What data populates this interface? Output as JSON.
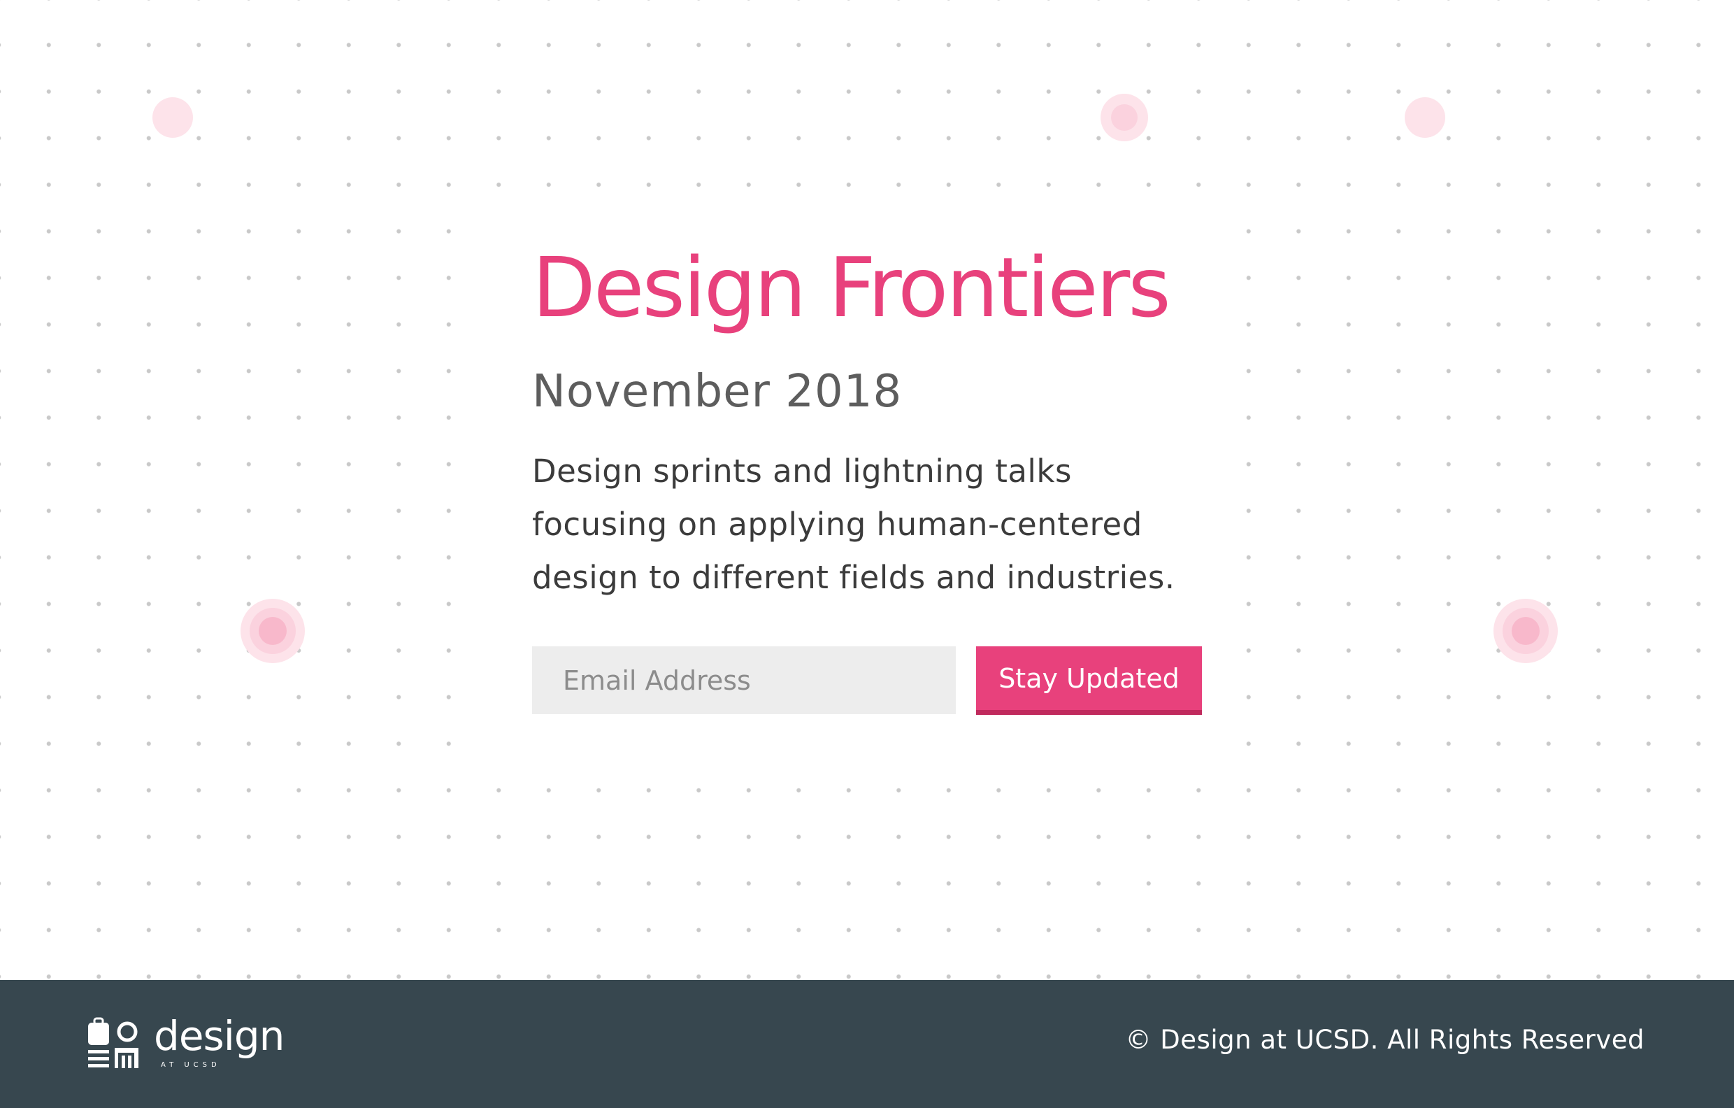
{
  "hero": {
    "title": "Design Frontiers",
    "date": "November 2018",
    "description": "Design sprints and lightning talks focusing on applying human-centered design to different fields and industries.",
    "email_placeholder": "Email Address",
    "email_value": "",
    "cta_label": "Stay Updated"
  },
  "footer": {
    "logo_word": "design",
    "logo_sub": "AT UCSD",
    "copyright": "© Design at UCSD. All Rights Reserved"
  },
  "theme": {
    "accent": "#e8417c",
    "accent_dark": "#c02a5d",
    "footer_bg": "#37474f",
    "dot_color": "#c9c9c9",
    "input_bg": "#ededed",
    "title_color": "#e8417c",
    "date_color": "#5d5d5d",
    "text_color": "#3b3b3b"
  },
  "icons": {
    "logo_mark": "design-at-ucsd-logo-icon"
  }
}
